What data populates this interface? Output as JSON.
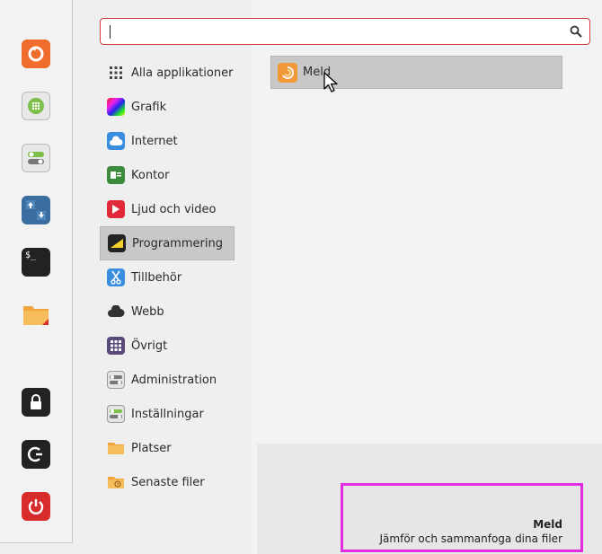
{
  "search": {
    "value": ""
  },
  "categories": [
    {
      "label": "Alla applikationer",
      "icon": "grid-dots-icon"
    },
    {
      "label": "Grafik",
      "icon": "graphics-icon"
    },
    {
      "label": "Internet",
      "icon": "cloud-icon"
    },
    {
      "label": "Kontor",
      "icon": "office-icon"
    },
    {
      "label": "Ljud och video",
      "icon": "play-icon"
    },
    {
      "label": "Programmering",
      "icon": "programming-icon"
    },
    {
      "label": "Tillbehör",
      "icon": "scissors-icon"
    },
    {
      "label": "Webb",
      "icon": "web-cloud-icon"
    },
    {
      "label": "Övrigt",
      "icon": "grid-icon"
    },
    {
      "label": "Administration",
      "icon": "toggles-icon"
    },
    {
      "label": "Inställningar",
      "icon": "settings-toggles-icon"
    },
    {
      "label": "Platser",
      "icon": "folder-icon"
    },
    {
      "label": "Senaste filer",
      "icon": "recent-folder-icon"
    }
  ],
  "selected_category": "Programmering",
  "apps": [
    {
      "label": "Meld",
      "icon": "meld-icon"
    }
  ],
  "description": {
    "name": "Meld",
    "text": "Jämför och sammanfoga dina filer"
  },
  "favorites": [
    {
      "icon": "firefox-icon",
      "color": "#ef6c2c"
    },
    {
      "icon": "app-grid-icon",
      "color": "#7cc04a"
    },
    {
      "icon": "settings-icon",
      "color": "#6b6b6b"
    },
    {
      "icon": "update-manager-icon",
      "color": "#3a6ea0"
    },
    {
      "icon": "terminal-icon",
      "color": "#222222"
    },
    {
      "icon": "folder-icon",
      "color": "#f2a53a"
    },
    {
      "icon": "lock-icon",
      "color": "#222222"
    },
    {
      "icon": "logout-icon",
      "color": "#222222"
    },
    {
      "icon": "power-icon",
      "color": "#d62c2c"
    }
  ]
}
